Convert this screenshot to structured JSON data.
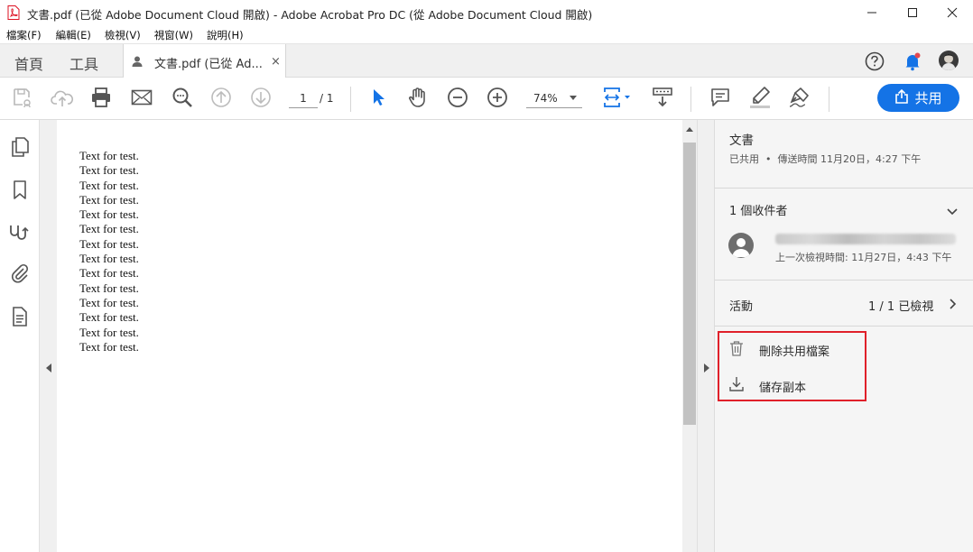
{
  "window": {
    "title": "文書.pdf (已從 Adobe Document Cloud 開啟) - Adobe Acrobat Pro DC (從 Adobe Document Cloud 開啟)"
  },
  "menu": [
    "檔案(F)",
    "編輯(E)",
    "檢視(V)",
    "視窗(W)",
    "說明(H)"
  ],
  "tabs": {
    "home": "首頁",
    "tools": "工具",
    "document": "文書.pdf (已從 Ad...",
    "close": "×"
  },
  "toolbar": {
    "page_current": "1",
    "page_total": "/ 1",
    "zoom": "74%",
    "share_label": "共用"
  },
  "document": {
    "lines": [
      "Text for test.",
      "Text for test.",
      "Text for test.",
      "Text for test.",
      "Text for test.",
      "Text for test.",
      "Text for test.",
      "Text for test.",
      "Text for test.",
      "Text for test.",
      "Text for test.",
      "Text for test.",
      "Text for test.",
      "Text for test."
    ]
  },
  "panel": {
    "doc_name": "文書",
    "shared_status": "已共用",
    "sent_time": "傳送時間 11月20日，4:27 下午",
    "recipients_label": "1 個收件者",
    "last_viewed": "上一次檢視時間: 11月27日，4:43 下午",
    "activity_label": "活動",
    "activity_value": "1 / 1 已檢視",
    "actions": {
      "delete": "刪除共用檔案",
      "save": "儲存副本"
    }
  },
  "colors": {
    "accent": "#1473e6",
    "highlight": "#e0202a",
    "notification": "#e34850"
  }
}
